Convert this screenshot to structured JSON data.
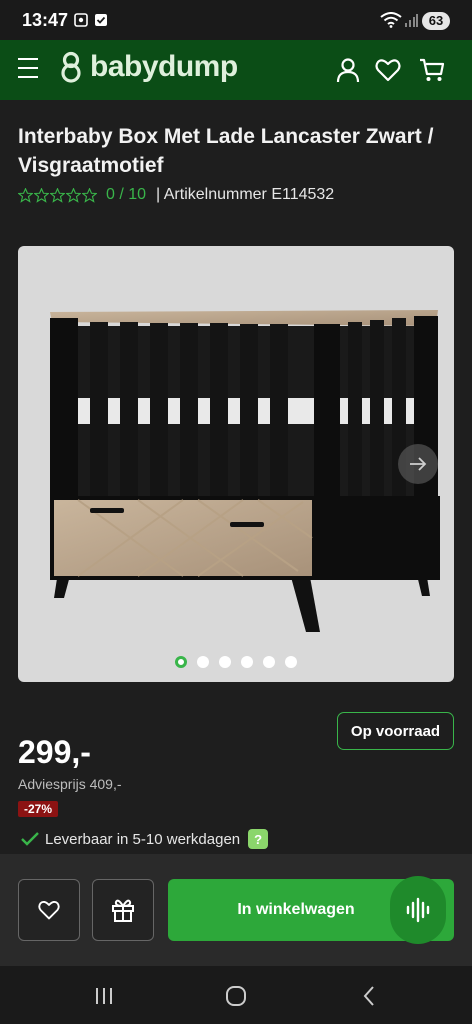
{
  "status": {
    "time": "13:47",
    "battery": "63"
  },
  "header": {
    "brand": "babydump"
  },
  "product": {
    "title": "Interbaby Box Met Lade Lancaster Zwart / Visgraatmotief",
    "rating": "0 / 10",
    "article": "| Artikelnummer  E114532",
    "stock": "Op voorraad",
    "price": "299,-",
    "advies": "Adviesprijs 409,-",
    "discount": "-27%",
    "delivery": "Leverbaar in 5-10 werkdagen",
    "help": "?"
  },
  "gallery": {
    "dot_count": 6,
    "active_index": 0
  },
  "actions": {
    "cart_label": "In winkelwagen"
  },
  "colors": {
    "header": "#0b4d16",
    "accent": "#39b54a",
    "cart": "#2da83a",
    "discount": "#8c1313"
  },
  "icons": [
    "menu-icon",
    "logo-icon",
    "account-icon",
    "heart-icon",
    "cart-icon",
    "star-icon",
    "arrow-right-icon",
    "check-icon",
    "gift-icon",
    "voice-icon",
    "recents-icon",
    "home-icon",
    "back-icon"
  ]
}
